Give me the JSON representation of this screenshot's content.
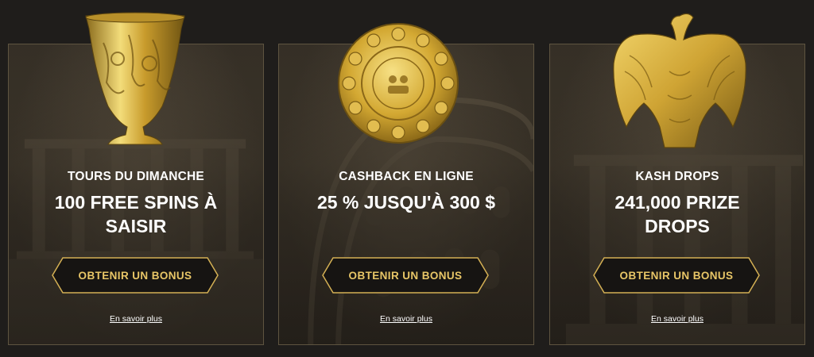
{
  "cards": [
    {
      "label": "TOURS DU DIMANCHE",
      "offer": "100 FREE SPINS À SAISIR",
      "button_label": "OBTENIR UN BONUS",
      "link_label": "En savoir plus",
      "artifact_icon": "golden-vase-icon",
      "background": "ruins"
    },
    {
      "label": "CASHBACK EN LIGNE",
      "offer": "25 % JUSQU'À 300 $",
      "button_label": "OBTENIR UN BONUS",
      "link_label": "En savoir plus",
      "artifact_icon": "golden-coin-icon",
      "background": "colosseum"
    },
    {
      "label": "KASH DROPS",
      "offer": "241,000 PRIZE DROPS",
      "button_label": "OBTENIR UN BONUS",
      "link_label": "En savoir plus",
      "artifact_icon": "golden-eagle-icon",
      "background": "columns"
    }
  ],
  "colors": {
    "gold": "#e8c667",
    "button_bg": "#161412",
    "card_border": "#5e5440",
    "page_bg": "#1f1d1b"
  }
}
